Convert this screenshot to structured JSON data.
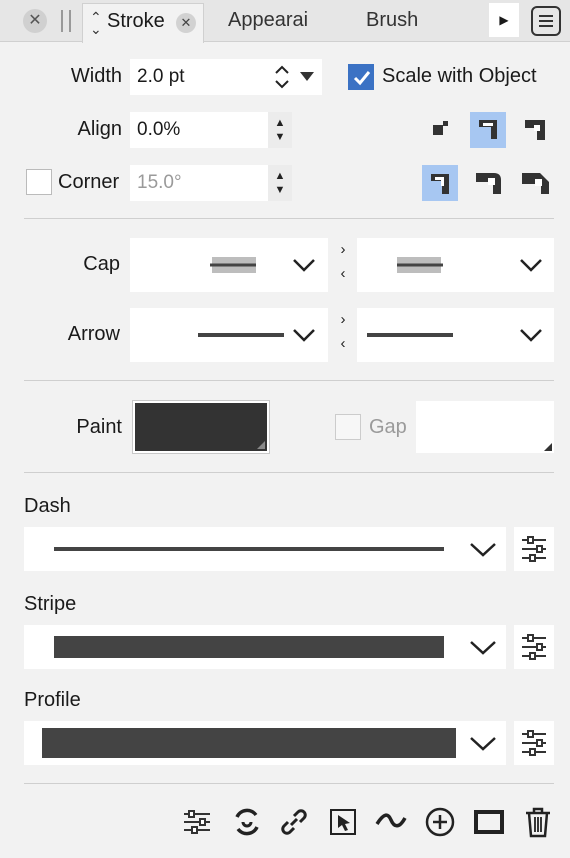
{
  "tabs": {
    "active": "Stroke",
    "appearance": "Appearai",
    "brush": "Brush"
  },
  "width": {
    "label": "Width",
    "value": "2.0 pt"
  },
  "scale": {
    "label": "Scale with Object",
    "checked": true
  },
  "align": {
    "label": "Align",
    "value": "0.0%"
  },
  "corner": {
    "label": "Corner",
    "value": "15.0°",
    "checked": false
  },
  "cap": {
    "label": "Cap"
  },
  "arrow": {
    "label": "Arrow"
  },
  "paint": {
    "label": "Paint",
    "color": "#333333"
  },
  "gap": {
    "label": "Gap",
    "checked": false
  },
  "dash": {
    "label": "Dash"
  },
  "stripe": {
    "label": "Stripe"
  },
  "profile": {
    "label": "Profile"
  },
  "colors": {
    "accent": "#3b72c4",
    "selected_bg": "#a7c7f2"
  },
  "icons": [
    "close-icon",
    "chevron-sort-icon",
    "play-icon",
    "menu-icon",
    "align-outside-icon",
    "align-center-icon",
    "align-inside-icon",
    "corner-miter-icon",
    "corner-round-icon",
    "corner-bevel-icon",
    "settings-sliders-icon",
    "refresh-icon",
    "link-icon",
    "select-arrow-icon",
    "wave-icon",
    "add-circle-icon",
    "rectangle-icon",
    "trash-icon"
  ]
}
